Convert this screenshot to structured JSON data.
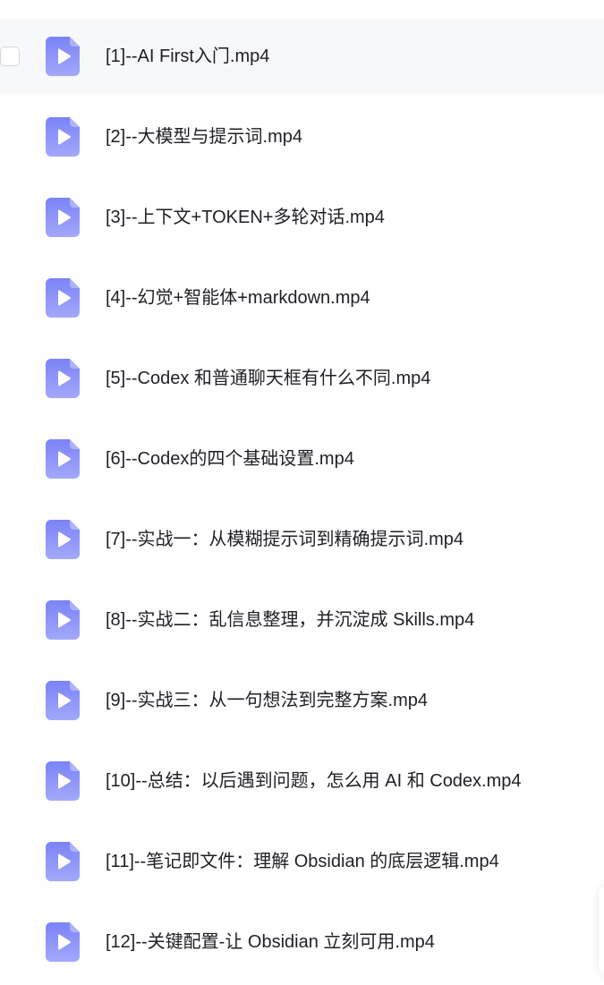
{
  "files": [
    {
      "name": "[1]--AI First入门.mp4",
      "icon": "video-file-icon",
      "hovered": true
    },
    {
      "name": "[2]--大模型与提示词.mp4",
      "icon": "video-file-icon"
    },
    {
      "name": "[3]--上下文+TOKEN+多轮对话.mp4",
      "icon": "video-file-icon"
    },
    {
      "name": "[4]--幻觉+智能体+markdown.mp4",
      "icon": "video-file-icon"
    },
    {
      "name": "[5]--Codex 和普通聊天框有什么不同.mp4",
      "icon": "video-file-icon"
    },
    {
      "name": "[6]--Codex的四个基础设置.mp4",
      "icon": "video-file-icon"
    },
    {
      "name": "[7]--实战一：从模糊提示词到精确提示词.mp4",
      "icon": "video-file-icon"
    },
    {
      "name": "[8]--实战二：乱信息整理，并沉淀成 Skills.mp4",
      "icon": "video-file-icon"
    },
    {
      "name": "[9]--实战三：从一句想法到完整方案.mp4",
      "icon": "video-file-icon"
    },
    {
      "name": "[10]--总结：以后遇到问题，怎么用 AI 和 Codex.mp4",
      "icon": "video-file-icon"
    },
    {
      "name": "[11]--笔记即文件：理解 Obsidian 的底层逻辑.mp4",
      "icon": "video-file-icon"
    },
    {
      "name": "[12]--关键配置-让 Obsidian 立刻可用.mp4",
      "icon": "video-file-icon"
    }
  ],
  "colors": {
    "icon_top": "#7b83f7",
    "icon_bottom": "#a3a8fb",
    "icon_play": "#ffffff",
    "hover_bg": "#f7f8fa",
    "text": "#1f1f26"
  }
}
